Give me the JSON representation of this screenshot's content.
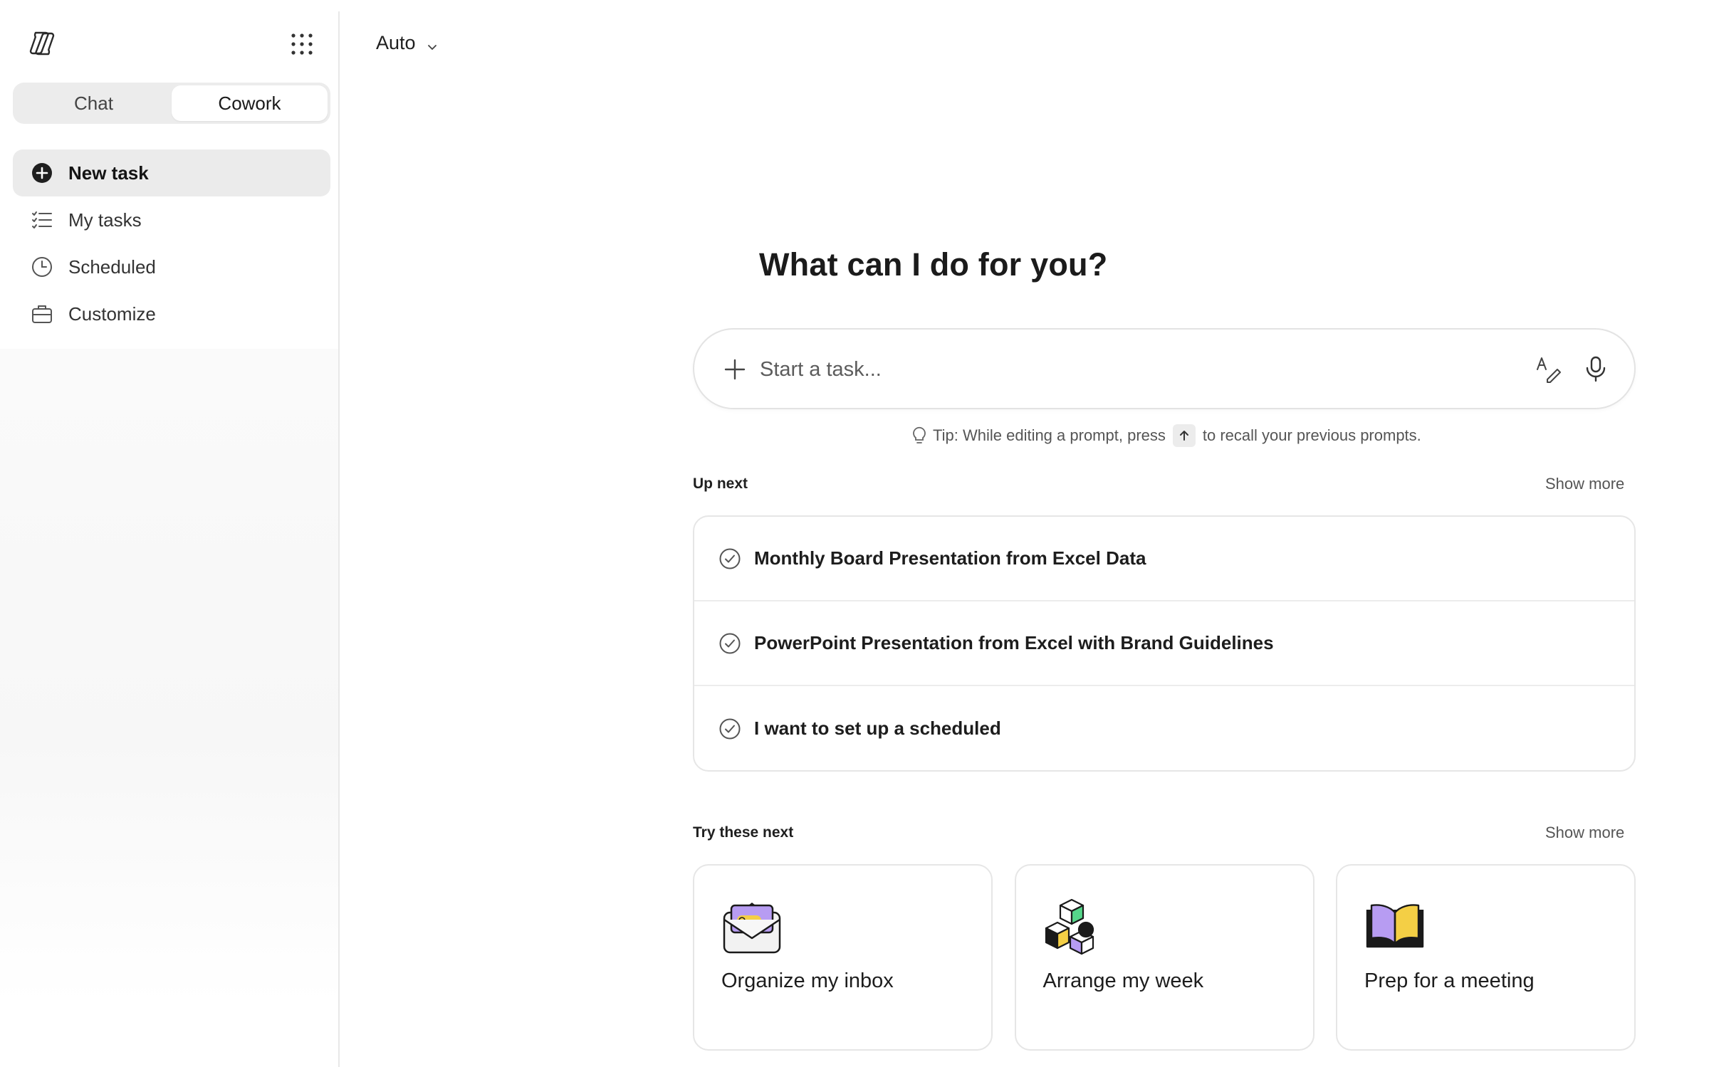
{
  "sidebar": {
    "logo_icon": "copilot-logo-icon",
    "apps_icon": "app-launcher-grid-icon",
    "mode_tabs": [
      {
        "label": "Chat",
        "active": false
      },
      {
        "label": "Cowork",
        "active": true
      }
    ],
    "nav": [
      {
        "label": "New task",
        "icon": "plus-circle-icon",
        "active": true
      },
      {
        "label": "My tasks",
        "icon": "task-list-icon",
        "active": false
      },
      {
        "label": "Scheduled",
        "icon": "clock-icon",
        "active": false
      },
      {
        "label": "Customize",
        "icon": "briefcase-icon",
        "active": false
      }
    ]
  },
  "header": {
    "model_label": "Auto"
  },
  "main": {
    "title": "What can I do for you?",
    "composer": {
      "placeholder": "Start a task...",
      "value": ""
    },
    "tip": {
      "before": "Tip: While editing a prompt, press",
      "key_icon": "arrow-up-icon",
      "after": "to recall your previous prompts."
    },
    "up_next": {
      "label": "Up next",
      "show_more": "Show more",
      "tasks": [
        "Monthly Board Presentation from Excel Data",
        "PowerPoint Presentation from Excel with Brand Guidelines",
        "I want to set up a scheduled"
      ]
    },
    "try_next": {
      "label": "Try these next",
      "show_more": "Show more",
      "cards": [
        {
          "label": "Organize my inbox",
          "icon": "envelope-illustration-icon"
        },
        {
          "label": "Arrange my week",
          "icon": "cubes-illustration-icon"
        },
        {
          "label": "Prep for a meeting",
          "icon": "open-book-illustration-icon"
        }
      ]
    }
  },
  "colors": {
    "accent_purple": "#b79cf2",
    "accent_yellow": "#f4cf45",
    "accent_green": "#55d68a",
    "active_bg": "#ebebeb",
    "border": "#e6e6e6"
  }
}
